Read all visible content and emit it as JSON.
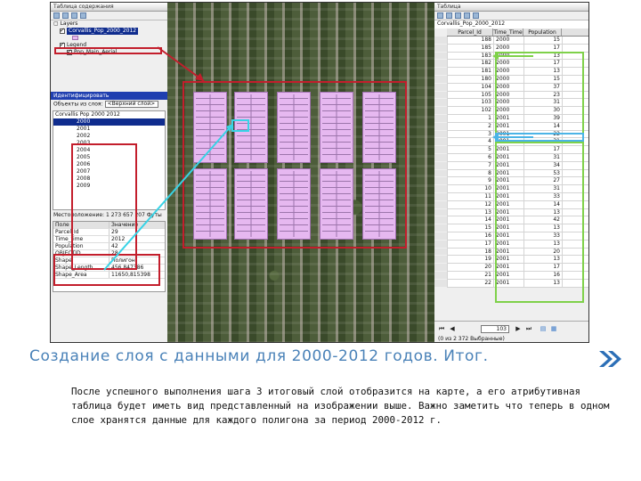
{
  "left_panel": {
    "title": "Таблица содержания",
    "layers_label": "Layers",
    "selected_layer": "Corvallis_Pop_2000_2012",
    "legend_label": "Legend",
    "legend_item": "Pop_Main_Aerial",
    "identify_title": "Идентифицировать",
    "identify_from_label": "Объекты из слоя:",
    "identify_from_value": "<Верхний слой>",
    "tree_root": "Corvallis Pop 2000 2012",
    "years": [
      "2000",
      "2001",
      "2002",
      "2003",
      "2004",
      "2005",
      "2006",
      "2007",
      "2008",
      "2009"
    ],
    "location_label": "Местоположение:",
    "location_value": "1 273 657 207 Футы",
    "attr_header": [
      "Поле",
      "Значение"
    ],
    "attributes": [
      [
        "Parcel_Id",
        "29"
      ],
      [
        "Time_time",
        "2012"
      ],
      [
        "Population",
        "42"
      ],
      [
        "OBJECTID",
        "28"
      ],
      [
        "Shape",
        "Полигон"
      ],
      [
        "Shape_Length",
        "456,847386"
      ],
      [
        "Shape_Area",
        "11650,815398"
      ]
    ]
  },
  "right_panel": {
    "title": "Таблица",
    "layer_name": "Corvallis_Pop_2000_2012",
    "columns": [
      "Parcel_Id",
      "Time_Time",
      "Population"
    ],
    "rows": [
      [
        "188",
        "2000",
        "15"
      ],
      [
        "185",
        "2000",
        "17"
      ],
      [
        "183",
        "2000",
        "13"
      ],
      [
        "182",
        "2000",
        "17"
      ],
      [
        "181",
        "2000",
        "13"
      ],
      [
        "180",
        "2000",
        "15"
      ],
      [
        "104",
        "2000",
        "37"
      ],
      [
        "105",
        "2000",
        "23"
      ],
      [
        "103",
        "2000",
        "31"
      ],
      [
        "102",
        "2000",
        "30"
      ],
      [
        "1",
        "2001",
        "39"
      ],
      [
        "2",
        "2001",
        "14"
      ],
      [
        "3",
        "2001",
        "22"
      ],
      [
        "4",
        "2001",
        "31"
      ],
      [
        "5",
        "2001",
        "17"
      ],
      [
        "6",
        "2001",
        "31"
      ],
      [
        "7",
        "2001",
        "34"
      ],
      [
        "8",
        "2001",
        "53"
      ],
      [
        "9",
        "2001",
        "27"
      ],
      [
        "10",
        "2001",
        "31"
      ],
      [
        "11",
        "2001",
        "33"
      ],
      [
        "12",
        "2001",
        "14"
      ],
      [
        "13",
        "2001",
        "13"
      ],
      [
        "14",
        "2001",
        "42"
      ],
      [
        "15",
        "2001",
        "13"
      ],
      [
        "16",
        "2001",
        "33"
      ],
      [
        "17",
        "2001",
        "13"
      ],
      [
        "18",
        "2001",
        "20"
      ],
      [
        "19",
        "2001",
        "13"
      ],
      [
        "20",
        "2001",
        "17"
      ],
      [
        "21",
        "2001",
        "16"
      ],
      [
        "22",
        "2001",
        "13"
      ]
    ],
    "record_current": "103",
    "status": "(0 из 2 372 Выбранные)"
  },
  "caption": "Создание слоя с данными для 2000-2012 годов. Итог.",
  "body": "После успешного выполнения шага 3 итоговый слой отобразится на карте, а его атрибутивная таблица будет иметь вид представленный на изображении выше. Важно заметить что теперь в одном слое хранятся данные для каждого полигона за период 2000-2012 г.",
  "colors": {
    "caption": "#4a82b8",
    "red_frame": "#c31e2c",
    "cyan": "#38d3e6",
    "green": "#7fd14a",
    "parcel": "#e6b8f0"
  },
  "icons": [
    "double-chevron-right-icon"
  ]
}
